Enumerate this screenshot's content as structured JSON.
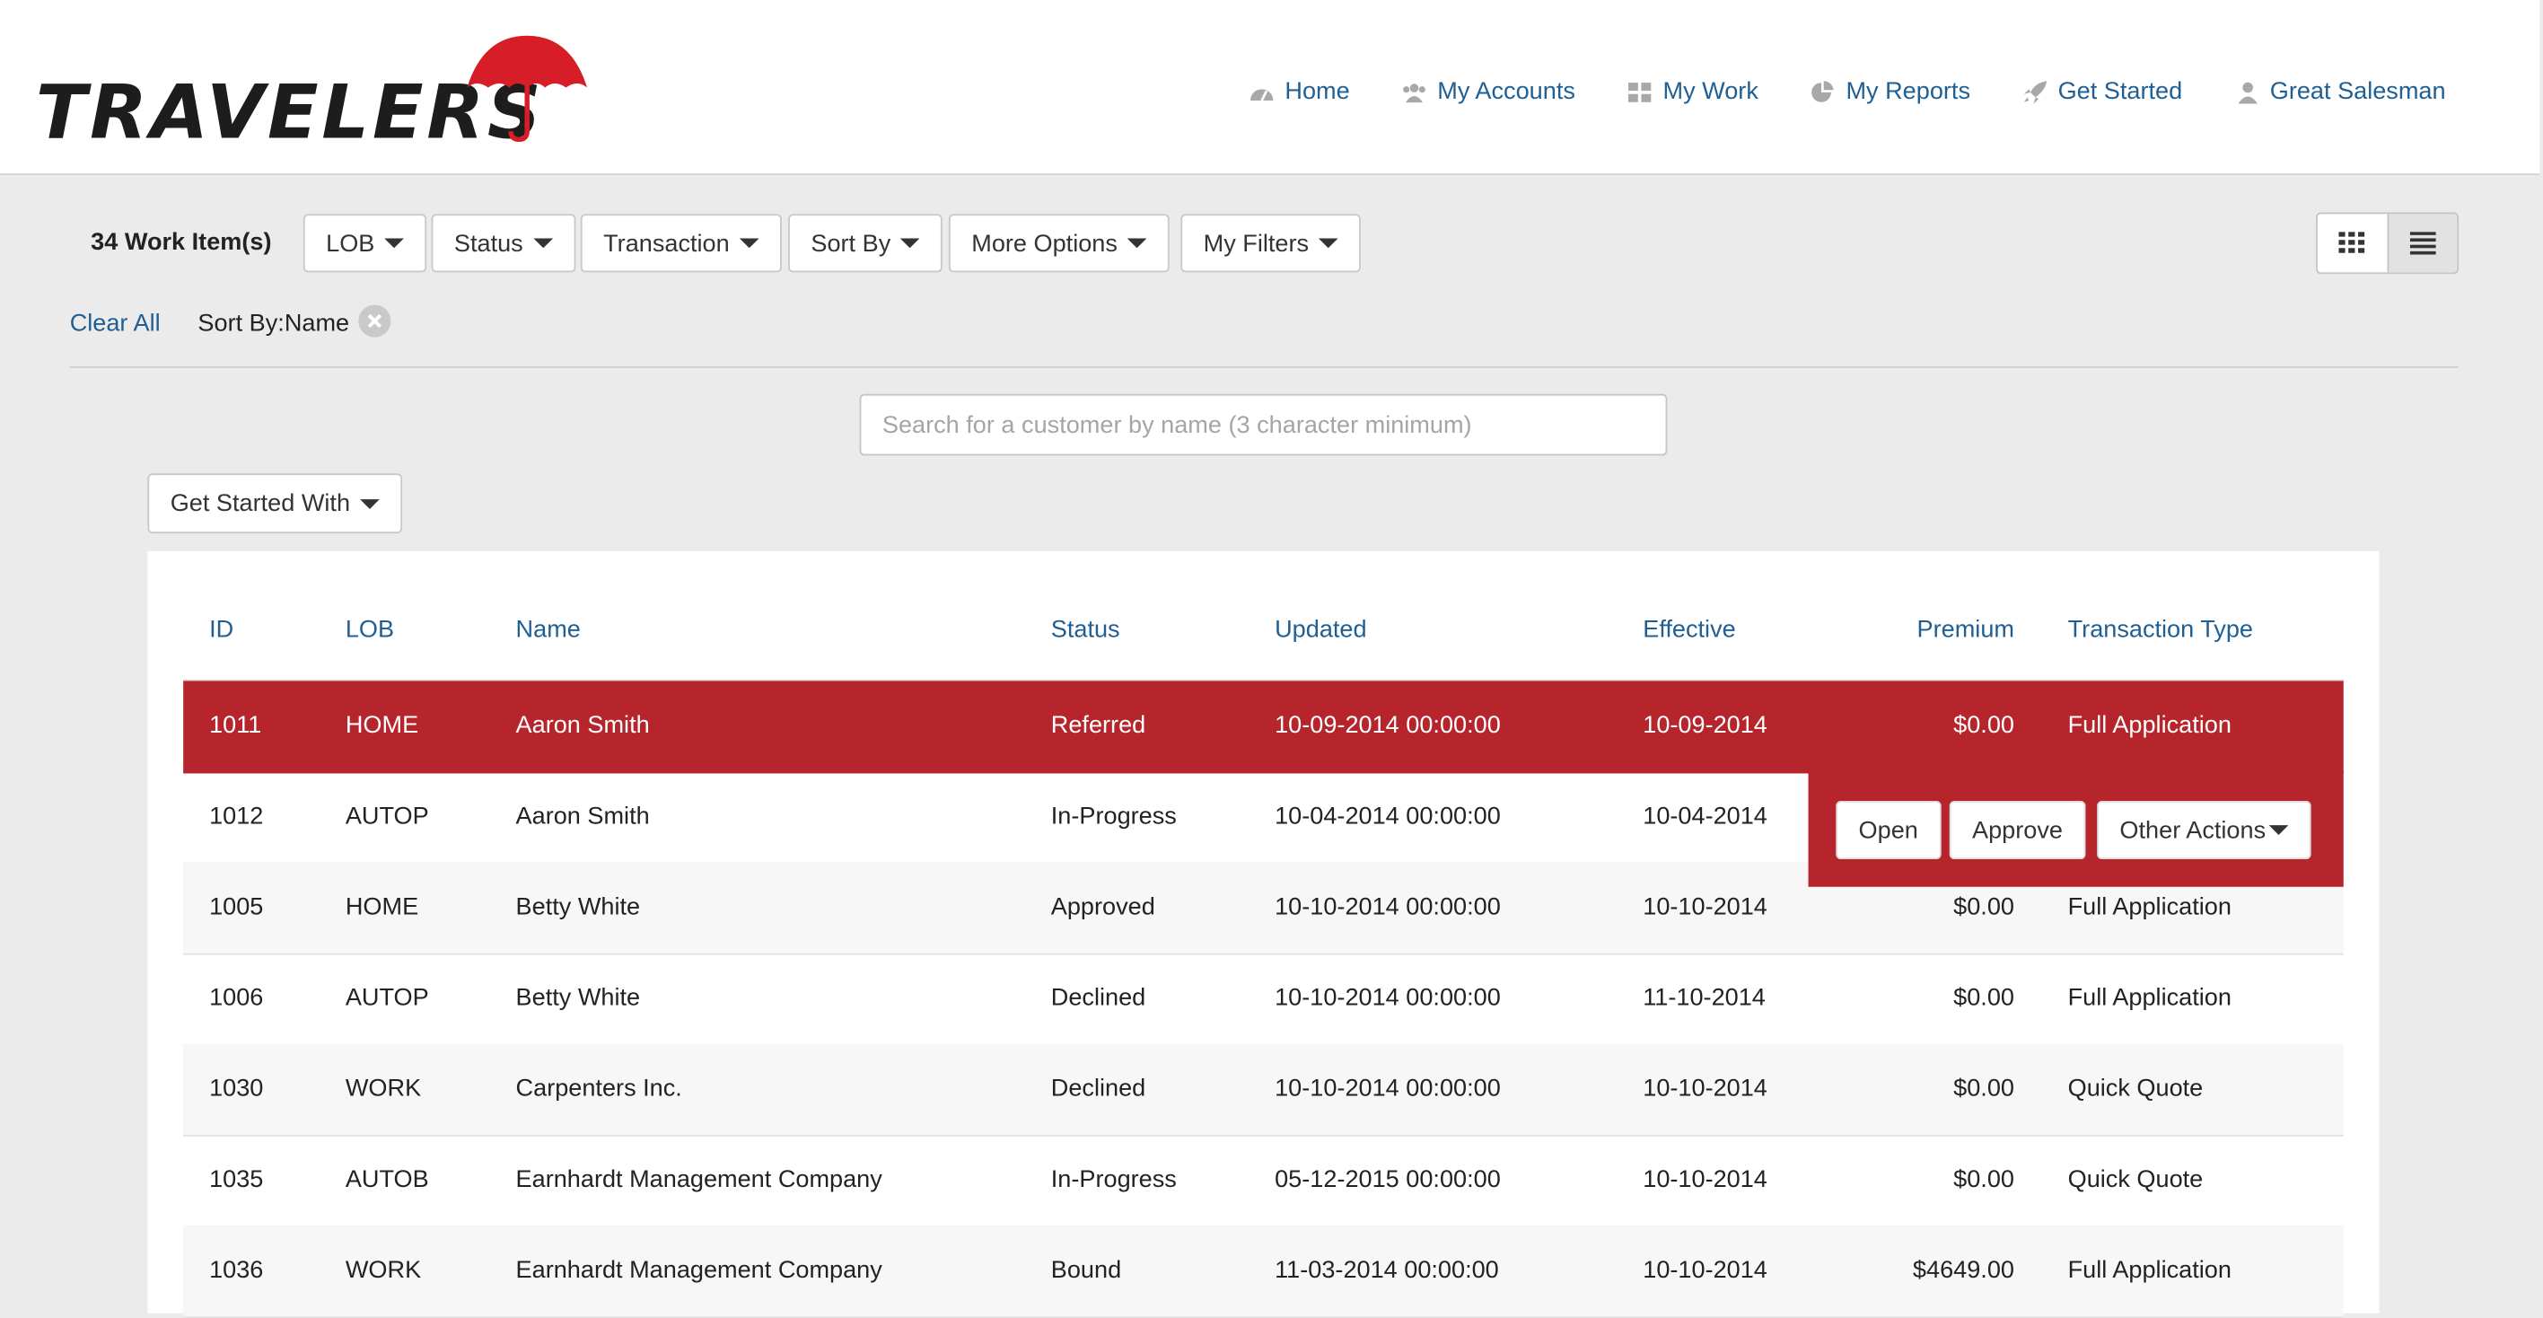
{
  "brand": {
    "name": "TRAVELERS",
    "accent": "#b5252b",
    "link_color": "#1f5f94"
  },
  "nav": [
    {
      "label": "Home",
      "icon": "dashboard-icon"
    },
    {
      "label": "My Accounts",
      "icon": "users-icon"
    },
    {
      "label": "My Work",
      "icon": "grid-icon"
    },
    {
      "label": "My Reports",
      "icon": "pie-chart-icon"
    },
    {
      "label": "Get Started",
      "icon": "rocket-icon"
    },
    {
      "label": "Great Salesman",
      "icon": "user-icon"
    }
  ],
  "toolbar": {
    "count_label": "34 Work Item(s)",
    "filters": [
      "LOB",
      "Status",
      "Transaction",
      "Sort By",
      "More Options",
      "My Filters"
    ],
    "view_modes": [
      "grid-view",
      "list-view"
    ],
    "active_view": "list-view"
  },
  "active_filters": {
    "clear_all": "Clear All",
    "sort_chip": "Sort By:Name"
  },
  "search": {
    "placeholder": "Search for a customer by name (3 character minimum)"
  },
  "get_started_with": "Get Started With",
  "table": {
    "columns": [
      "ID",
      "LOB",
      "Name",
      "Status",
      "Updated",
      "Effective",
      "Premium",
      "Transaction Type"
    ],
    "rows": [
      [
        "1011",
        "HOME",
        "Aaron Smith",
        "Referred",
        "10-09-2014 00:00:00",
        "10-09-2014",
        "$0.00",
        "Full Application"
      ],
      [
        "1012",
        "AUTOP",
        "Aaron Smith",
        "In-Progress",
        "10-04-2014 00:00:00",
        "10-04-2014",
        "",
        ""
      ],
      [
        "1005",
        "HOME",
        "Betty White",
        "Approved",
        "10-10-2014 00:00:00",
        "10-10-2014",
        "$0.00",
        "Full Application"
      ],
      [
        "1006",
        "AUTOP",
        "Betty White",
        "Declined",
        "10-10-2014 00:00:00",
        "11-10-2014",
        "$0.00",
        "Full Application"
      ],
      [
        "1030",
        "WORK",
        "Carpenters Inc.",
        "Declined",
        "10-10-2014 00:00:00",
        "10-10-2014",
        "$0.00",
        "Quick Quote"
      ],
      [
        "1035",
        "AUTOB",
        "Earnhardt Management Company",
        "In-Progress",
        "05-12-2015 00:00:00",
        "10-10-2014",
        "$0.00",
        "Quick Quote"
      ],
      [
        "1036",
        "WORK",
        "Earnhardt Management Company",
        "Bound",
        "11-03-2014 00:00:00",
        "10-10-2014",
        "$4649.00",
        "Full Application"
      ]
    ],
    "selected_row_id": "1011"
  },
  "row_actions": {
    "open": "Open",
    "approve": "Approve",
    "other": "Other Actions"
  }
}
